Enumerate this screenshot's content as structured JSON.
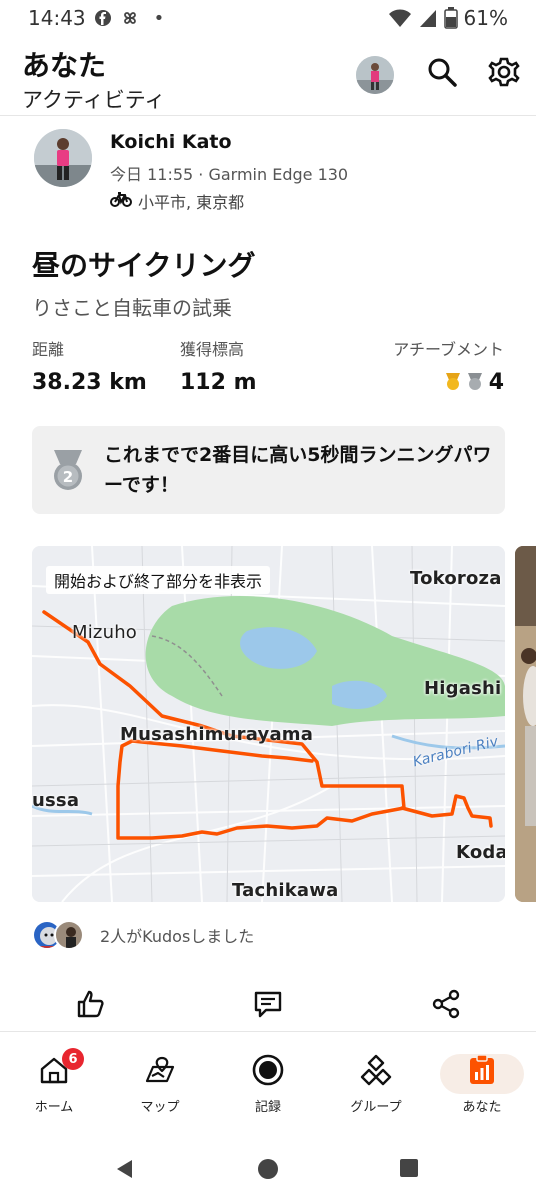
{
  "status_bar": {
    "time": "14:43",
    "battery": "61%",
    "dot": "•"
  },
  "header": {
    "title": "あなた",
    "subtitle": "アクティビティ"
  },
  "activity": {
    "athlete_name": "Koichi Kato",
    "meta": "今日 11:55 · Garmin Edge 130",
    "location": "小平市, 東京都",
    "title": "昼のサイクリング",
    "description": "りさこと自転車の試乗",
    "stats": {
      "distance_label": "距離",
      "distance_value": "38.23 km",
      "elevation_label": "獲得標高",
      "elevation_value": "112 m",
      "achievements_label": "アチーブメント",
      "achievements_value": "4"
    },
    "highlight": {
      "medal_number": "2",
      "text": "これまでで2番目に高い5秒間ランニングパワーです！"
    }
  },
  "map": {
    "hide_button": "開始および終了部分を非表示",
    "labels": {
      "tokorozawa": "Tokoroza",
      "mizuho": "Mizuho",
      "higashi": "Higashi",
      "musashimurayama": "Musashimurayama",
      "karabori": "Karabori Riv",
      "ussa": "ussa",
      "koda": "Koda",
      "tachikawa": "Tachikawa"
    },
    "route_color": "#fc5200"
  },
  "kudos": {
    "text": "2人がKudosしました"
  },
  "nav": {
    "items": [
      {
        "label": "ホーム",
        "icon": "home-icon",
        "badge": "6"
      },
      {
        "label": "マップ",
        "icon": "map-icon"
      },
      {
        "label": "記録",
        "icon": "record-icon"
      },
      {
        "label": "グループ",
        "icon": "groups-icon"
      },
      {
        "label": "あなた",
        "icon": "you-icon"
      }
    ]
  },
  "colors": {
    "accent": "#fc5200",
    "badge": "#e8262f",
    "active_pill": "#f7ede6"
  }
}
